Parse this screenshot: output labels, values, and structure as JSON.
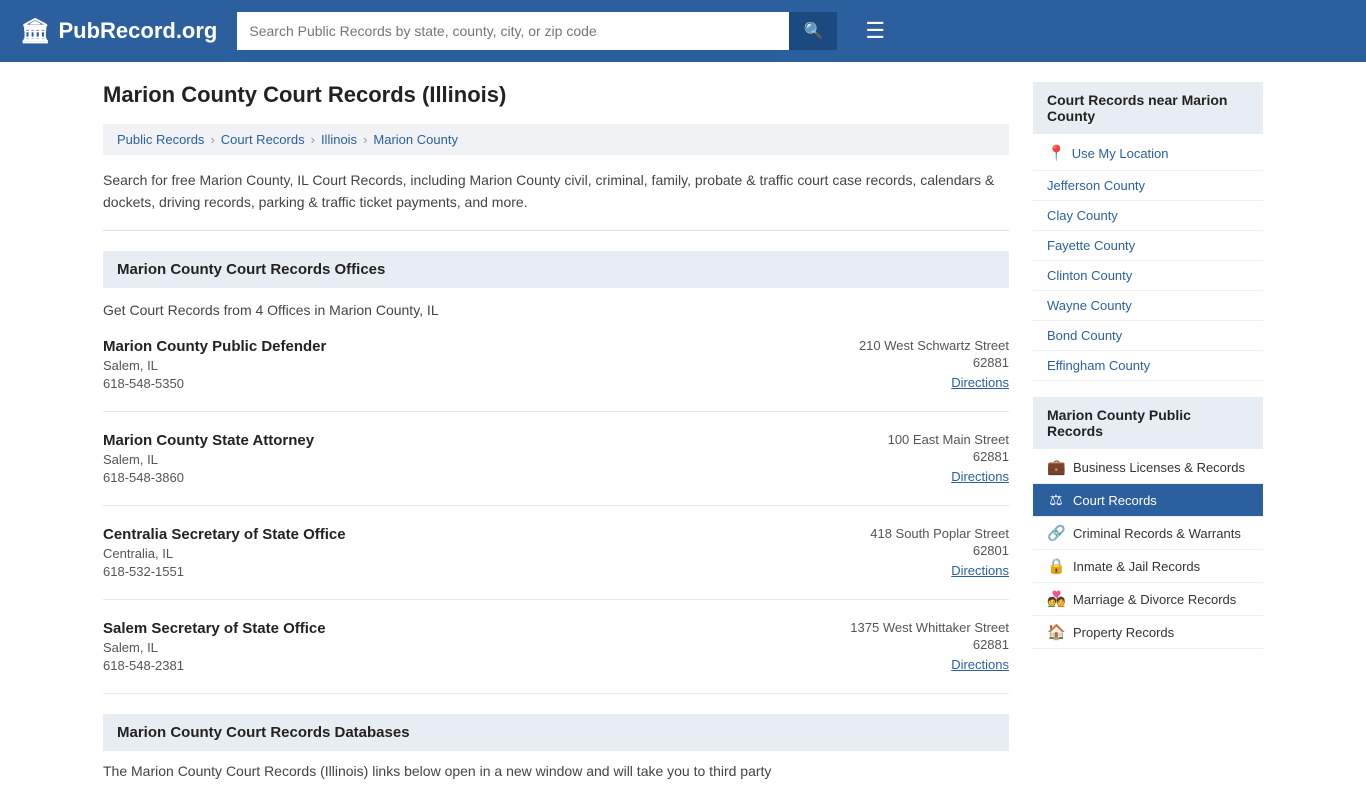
{
  "header": {
    "logo_text": "PubRecord.org",
    "search_placeholder": "Search Public Records by state, county, city, or zip code",
    "search_icon": "🔍",
    "menu_icon": "☰"
  },
  "page": {
    "title": "Marion County Court Records (Illinois)",
    "breadcrumb": [
      {
        "label": "Public Records",
        "href": "#"
      },
      {
        "label": "Court Records",
        "href": "#"
      },
      {
        "label": "Illinois",
        "href": "#"
      },
      {
        "label": "Marion County",
        "href": "#"
      }
    ],
    "description": "Search for free Marion County, IL Court Records, including Marion County civil, criminal, family, probate & traffic court case records, calendars & dockets, driving records, parking & traffic ticket payments, and more.",
    "offices_section_title": "Marion County Court Records Offices",
    "offices_count_text": "Get Court Records from 4 Offices in Marion County, IL",
    "offices": [
      {
        "name": "Marion County Public Defender",
        "city": "Salem, IL",
        "phone": "618-548-5350",
        "street": "210 West Schwartz Street",
        "zip": "62881",
        "directions_label": "Directions"
      },
      {
        "name": "Marion County State Attorney",
        "city": "Salem, IL",
        "phone": "618-548-3860",
        "street": "100 East Main Street",
        "zip": "62881",
        "directions_label": "Directions"
      },
      {
        "name": "Centralia Secretary of State Office",
        "city": "Centralia, IL",
        "phone": "618-532-1551",
        "street": "418 South Poplar Street",
        "zip": "62801",
        "directions_label": "Directions"
      },
      {
        "name": "Salem Secretary of State Office",
        "city": "Salem, IL",
        "phone": "618-548-2381",
        "street": "1375 West Whittaker Street",
        "zip": "62881",
        "directions_label": "Directions"
      }
    ],
    "databases_section_title": "Marion County Court Records Databases",
    "databases_description": "The Marion County Court Records (Illinois) links below open in a new window and will take you to third party"
  },
  "sidebar": {
    "nearby_title": "Court Records near Marion County",
    "use_my_location": "Use My Location",
    "nearby_counties": [
      "Jefferson County",
      "Clay County",
      "Fayette County",
      "Clinton County",
      "Wayne County",
      "Bond County",
      "Effingham County"
    ],
    "public_records_title": "Marion County Public Records",
    "public_records_items": [
      {
        "label": "Business Licenses & Records",
        "icon": "💼",
        "active": false
      },
      {
        "label": "Court Records",
        "icon": "⚖",
        "active": true
      },
      {
        "label": "Criminal Records & Warrants",
        "icon": "🔗",
        "active": false
      },
      {
        "label": "Inmate & Jail Records",
        "icon": "🔒",
        "active": false
      },
      {
        "label": "Marriage & Divorce Records",
        "icon": "💑",
        "active": false
      },
      {
        "label": "Property Records",
        "icon": "🏠",
        "active": false
      }
    ]
  }
}
